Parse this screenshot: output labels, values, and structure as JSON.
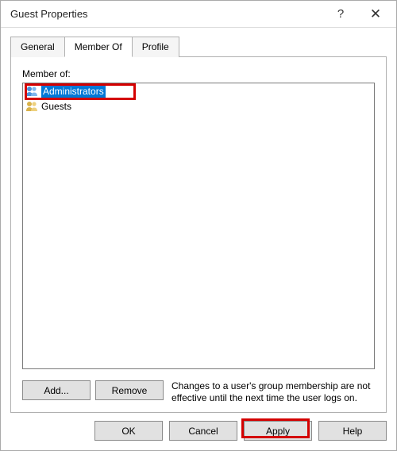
{
  "window": {
    "title": "Guest Properties"
  },
  "tabs": {
    "general": "General",
    "memberof": "Member Of",
    "profile": "Profile",
    "active_index": 1
  },
  "memberof": {
    "label": "Member of:",
    "items": [
      {
        "name": "Administrators",
        "selected": true
      },
      {
        "name": "Guests",
        "selected": false
      }
    ],
    "add_button": "Add...",
    "remove_button": "Remove",
    "hint": "Changes to a user's group membership are not effective until the next time the user logs on."
  },
  "dialog_buttons": {
    "ok": "OK",
    "cancel": "Cancel",
    "apply": "Apply",
    "help": "Help"
  },
  "highlights": {
    "admin_row": true,
    "apply_button": true
  }
}
